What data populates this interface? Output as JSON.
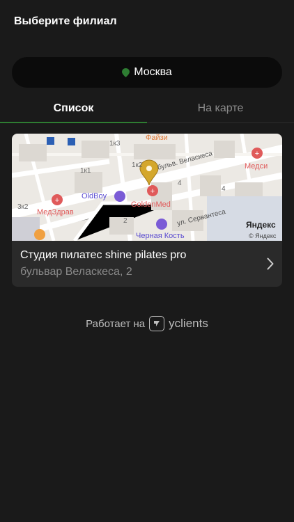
{
  "header": {
    "title": "Выберите филиал"
  },
  "city": {
    "label": "Москва"
  },
  "tabs": [
    {
      "label": "Список"
    },
    {
      "label": "На карте"
    }
  ],
  "branch": {
    "name": "Студия пилатес shine pilates pro",
    "address": "бульвар Веласкеса, 2"
  },
  "map": {
    "labels": {
      "faizi": "Файзи",
      "medsi": "Медси",
      "oldboy": "OldBoy",
      "goldenmed": "GoldenMed",
      "medzdrav": "МедЗдрав",
      "chernaya": "Черная Кость",
      "street1": "бульв. Веласкеса",
      "street2": "ул. Сервантеса",
      "b1": "1к3",
      "b2": "1к1",
      "b3": "1к2",
      "b4": "3к2",
      "n4a": "4",
      "n4b": "4",
      "n2": "2",
      "yandex": "Яндекс",
      "copyright": "© Яндекс"
    }
  },
  "footer": {
    "powered": "Работает на",
    "brand": "yclients"
  },
  "colors": {
    "accent": "#2e7d32",
    "background": "#1a1a1a",
    "card": "#2a2a2a"
  }
}
